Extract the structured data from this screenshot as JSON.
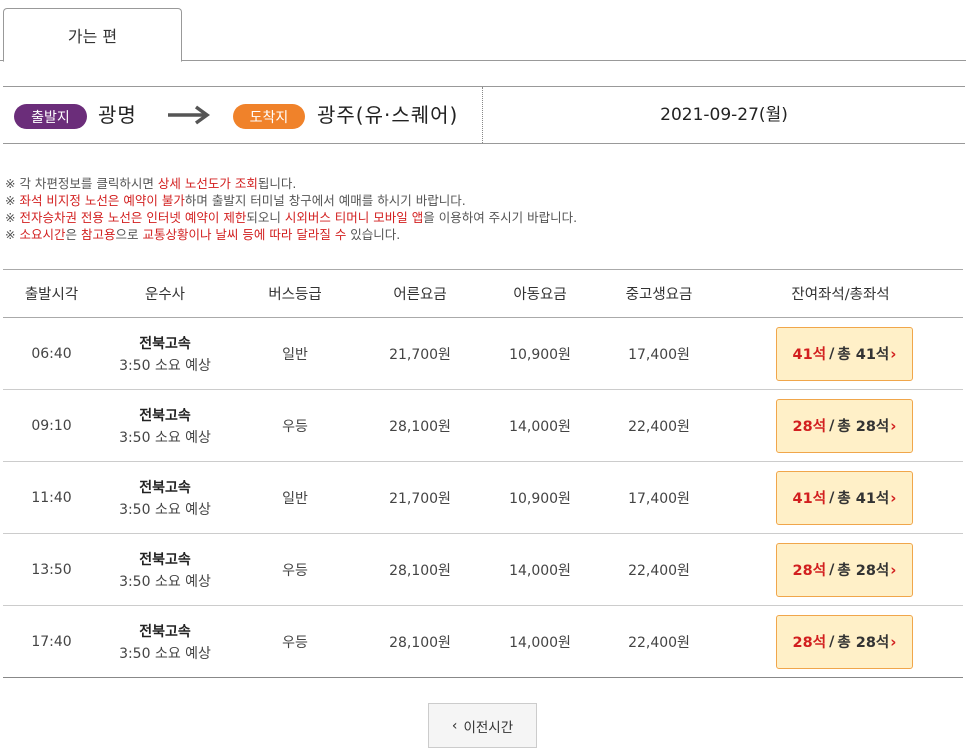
{
  "tabs": [
    {
      "label": "가는 편"
    }
  ],
  "route": {
    "departure_badge": "출발지",
    "departure_name": "광명",
    "arrival_badge": "도착지",
    "arrival_name": "광주(유·스퀘어)",
    "date": "2021-09-27(월)"
  },
  "colors": {
    "departure_badge": "#6b2d7a",
    "arrival_badge": "#f0822a",
    "highlight": "#d21f1f",
    "seat_button_bg": "#fff0c8",
    "seat_button_border": "#f0a64b"
  },
  "notices": [
    [
      {
        "t": "※ 각 차편정보를 클릭하시면 "
      },
      {
        "t": "상세 노선도가 조회",
        "red": true
      },
      {
        "t": "됩니다."
      }
    ],
    [
      {
        "t": "※ "
      },
      {
        "t": "좌석 비지정 노선은 예약이 불가",
        "red": true
      },
      {
        "t": "하며 출발지 터미널 창구에서 예매를 하시기 바랍니다."
      }
    ],
    [
      {
        "t": "※ "
      },
      {
        "t": "전자승차권 전용 노선은 인터넷 예약이 제한",
        "red": true
      },
      {
        "t": "되오니 "
      },
      {
        "t": "시외버스 티머니 모바일 앱",
        "red": true
      },
      {
        "t": "을 이용하여 주시기 바랍니다."
      }
    ],
    [
      {
        "t": "※ "
      },
      {
        "t": "소요시간",
        "red": true
      },
      {
        "t": "은 "
      },
      {
        "t": "참고용",
        "red": true
      },
      {
        "t": "으로 "
      },
      {
        "t": "교통상황이나 날씨 등에 따라 달라질 수",
        "red": true
      },
      {
        "t": " 있습니다."
      }
    ]
  ],
  "table": {
    "headers": {
      "time": "출발시각",
      "company": "운수사",
      "grade": "버스등급",
      "adult": "어른요금",
      "child": "아동요금",
      "youth": "중고생요금",
      "seats": "잔여좌석/총좌석"
    },
    "rows": [
      {
        "time": "06:40",
        "company": "전북고속",
        "duration": "3:50 소요 예상",
        "grade": "일반",
        "adult": "21,700원",
        "child": "10,900원",
        "youth": "17,400원",
        "remain": "41석",
        "sep": "/",
        "total": "총 41석"
      },
      {
        "time": "09:10",
        "company": "전북고속",
        "duration": "3:50 소요 예상",
        "grade": "우등",
        "adult": "28,100원",
        "child": "14,000원",
        "youth": "22,400원",
        "remain": "28석",
        "sep": "/",
        "total": "총 28석"
      },
      {
        "time": "11:40",
        "company": "전북고속",
        "duration": "3:50 소요 예상",
        "grade": "일반",
        "adult": "21,700원",
        "child": "10,900원",
        "youth": "17,400원",
        "remain": "41석",
        "sep": "/",
        "total": "총 41석"
      },
      {
        "time": "13:50",
        "company": "전북고속",
        "duration": "3:50 소요 예상",
        "grade": "우등",
        "adult": "28,100원",
        "child": "14,000원",
        "youth": "22,400원",
        "remain": "28석",
        "sep": "/",
        "total": "총 28석"
      },
      {
        "time": "17:40",
        "company": "전북고속",
        "duration": "3:50 소요 예상",
        "grade": "우등",
        "adult": "28,100원",
        "child": "14,000원",
        "youth": "22,400원",
        "remain": "28석",
        "sep": "/",
        "total": "총 28석"
      }
    ]
  },
  "pagination": {
    "prev_label": "이전시간",
    "prev_icon": "chevron-left-icon"
  },
  "icons": {
    "route_arrow": "arrow-right-icon",
    "seat_chevron": "chevron-right-icon"
  }
}
